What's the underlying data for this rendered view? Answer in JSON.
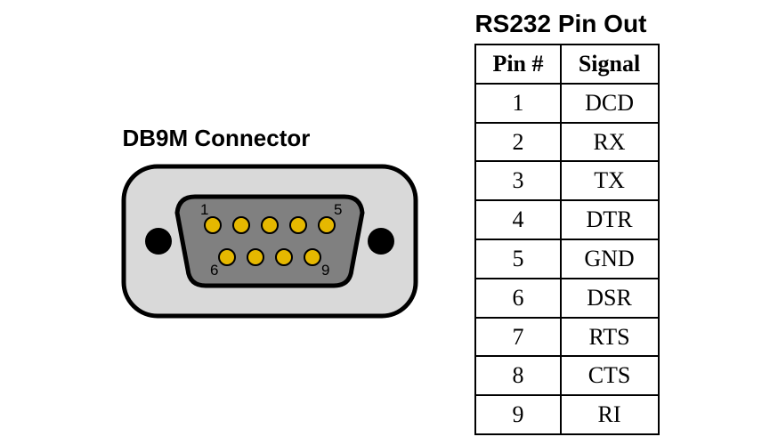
{
  "connector_label": "DB9M Connector",
  "table_title": "RS232 Pin Out",
  "columns": [
    "Pin #",
    "Signal"
  ],
  "rows": [
    {
      "pin": "1",
      "signal": "DCD"
    },
    {
      "pin": "2",
      "signal": "RX"
    },
    {
      "pin": "3",
      "signal": "TX"
    },
    {
      "pin": "4",
      "signal": "DTR"
    },
    {
      "pin": "5",
      "signal": "GND"
    },
    {
      "pin": "6",
      "signal": "DSR"
    },
    {
      "pin": "7",
      "signal": "RTS"
    },
    {
      "pin": "8",
      "signal": "CTS"
    },
    {
      "pin": "9",
      "signal": "RI"
    }
  ],
  "pin_labels": {
    "tl": "1",
    "tr": "5",
    "bl": "6",
    "br": "9"
  },
  "colors": {
    "outer_plate": "#d9d9d9",
    "inner_shell": "#808080",
    "pin_gold": "#e6b800",
    "screw": "#000000"
  }
}
